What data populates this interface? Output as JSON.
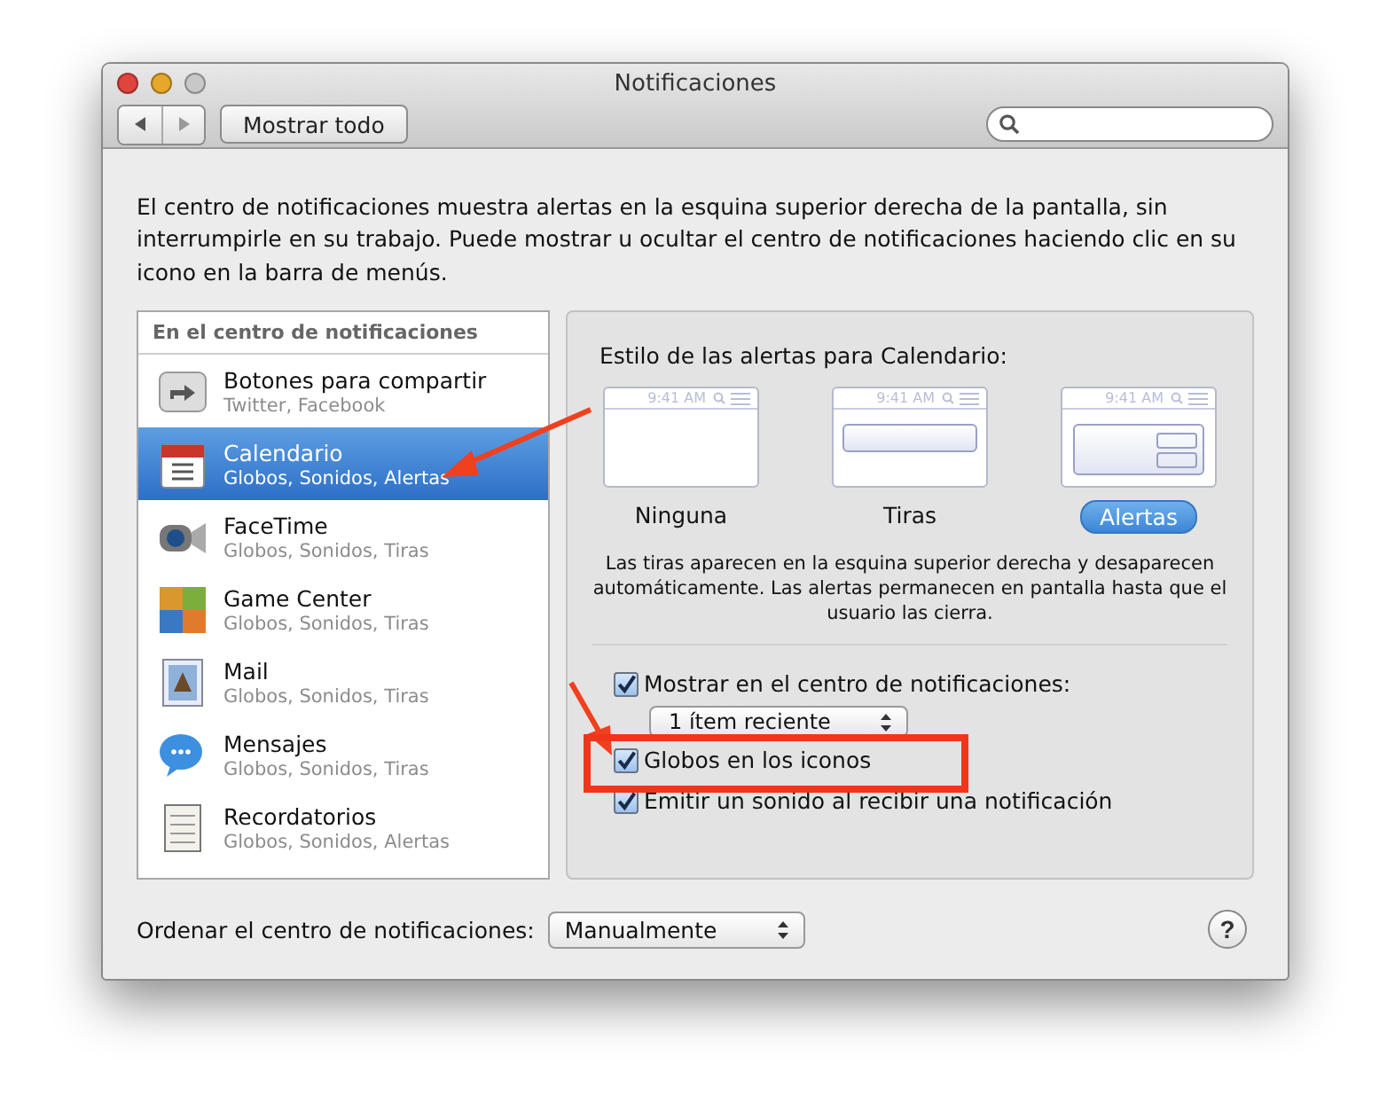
{
  "window": {
    "title": "Notificaciones"
  },
  "toolbar": {
    "show_all_button": "Mostrar todo"
  },
  "description": "El centro de notificaciones muestra alertas en la esquina superior derecha de la pantalla, sin interrumpirle en su trabajo. Puede mostrar u ocultar el centro de notificaciones haciendo clic en su icono en la barra de menús.",
  "sidebar": {
    "header": "En el centro de notificaciones",
    "items": [
      {
        "title": "Botones para compartir",
        "subtitle": "Twitter, Facebook",
        "selected": false
      },
      {
        "title": "Calendario",
        "subtitle": "Globos, Sonidos, Alertas",
        "selected": true
      },
      {
        "title": "FaceTime",
        "subtitle": "Globos, Sonidos, Tiras",
        "selected": false
      },
      {
        "title": "Game Center",
        "subtitle": "Globos, Sonidos, Tiras",
        "selected": false
      },
      {
        "title": "Mail",
        "subtitle": "Globos, Sonidos, Tiras",
        "selected": false
      },
      {
        "title": "Mensajes",
        "subtitle": "Globos, Sonidos, Tiras",
        "selected": false
      },
      {
        "title": "Recordatorios",
        "subtitle": "Globos, Sonidos, Alertas",
        "selected": false
      }
    ]
  },
  "detail": {
    "heading": "Estilo de las alertas para Calendario:",
    "styles": [
      {
        "kind": "none",
        "time": "9:41 AM",
        "label": "Ninguna",
        "selected": false
      },
      {
        "kind": "banner",
        "time": "9:41 AM",
        "label": "Tiras",
        "selected": false
      },
      {
        "kind": "alert",
        "time": "9:41 AM",
        "label": "Alertas",
        "selected": true
      }
    ],
    "note": "Las tiras aparecen en la esquina superior derecha y desaparecen automáticamente. Las alertas permanecen en pantalla hasta que el usuario las cierra.",
    "options": [
      {
        "kind": "checkbox",
        "label": "Mostrar en el centro de notificaciones:",
        "checked": true
      },
      {
        "kind": "select",
        "value": "1 ítem reciente"
      },
      {
        "kind": "checkbox",
        "label": "Globos en los iconos",
        "checked": true
      },
      {
        "kind": "checkbox",
        "label": "Emitir un sonido al recibir una notificación",
        "checked": true
      }
    ]
  },
  "footer": {
    "sort_label": "Ordenar el centro de notificaciones:",
    "sort_value": "Manualmente",
    "help": "?"
  }
}
